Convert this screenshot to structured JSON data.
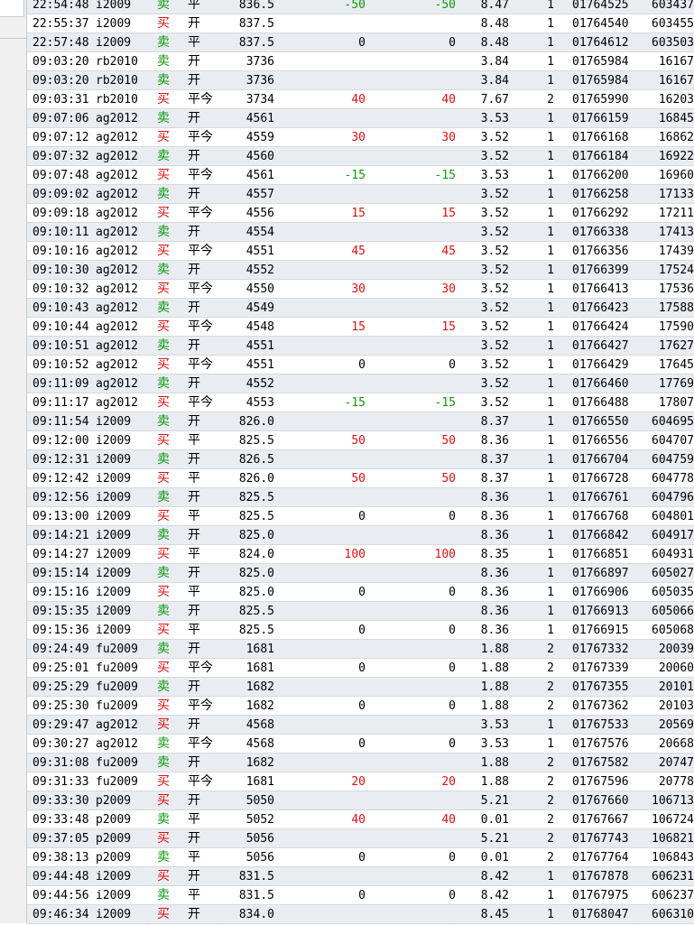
{
  "colors": {
    "buy": "#e01010",
    "sell": "#0a9a0a",
    "profit": "#e01010",
    "loss": "#0a9a0a",
    "row_alt": "#e9ecf1"
  },
  "rows": [
    {
      "time": "22:54:48",
      "symbol": "i2009",
      "dir": "卖",
      "oc": "平",
      "price": "836.5",
      "pl": "-50",
      "pl2": "-50",
      "fee": "8.47",
      "qty": "1",
      "order": "01764525",
      "id": "603437"
    },
    {
      "time": "22:55:37",
      "symbol": "i2009",
      "dir": "买",
      "oc": "开",
      "price": "837.5",
      "pl": "",
      "pl2": "",
      "fee": "8.48",
      "qty": "1",
      "order": "01764540",
      "id": "603455"
    },
    {
      "time": "22:57:48",
      "symbol": "i2009",
      "dir": "卖",
      "oc": "平",
      "price": "837.5",
      "pl": "0",
      "pl2": "0",
      "fee": "8.48",
      "qty": "1",
      "order": "01764612",
      "id": "603503"
    },
    {
      "time": "09:03:20",
      "symbol": "rb2010",
      "dir": "卖",
      "oc": "开",
      "price": "3736",
      "pl": "",
      "pl2": "",
      "fee": "3.84",
      "qty": "1",
      "order": "01765984",
      "id": "16167"
    },
    {
      "time": "09:03:20",
      "symbol": "rb2010",
      "dir": "卖",
      "oc": "开",
      "price": "3736",
      "pl": "",
      "pl2": "",
      "fee": "3.84",
      "qty": "1",
      "order": "01765984",
      "id": "16167"
    },
    {
      "time": "09:03:31",
      "symbol": "rb2010",
      "dir": "买",
      "oc": "平今",
      "price": "3734",
      "pl": "40",
      "pl2": "40",
      "fee": "7.67",
      "qty": "2",
      "order": "01765990",
      "id": "16203"
    },
    {
      "time": "09:07:06",
      "symbol": "ag2012",
      "dir": "卖",
      "oc": "开",
      "price": "4561",
      "pl": "",
      "pl2": "",
      "fee": "3.53",
      "qty": "1",
      "order": "01766159",
      "id": "16845"
    },
    {
      "time": "09:07:12",
      "symbol": "ag2012",
      "dir": "买",
      "oc": "平今",
      "price": "4559",
      "pl": "30",
      "pl2": "30",
      "fee": "3.52",
      "qty": "1",
      "order": "01766168",
      "id": "16862"
    },
    {
      "time": "09:07:32",
      "symbol": "ag2012",
      "dir": "卖",
      "oc": "开",
      "price": "4560",
      "pl": "",
      "pl2": "",
      "fee": "3.52",
      "qty": "1",
      "order": "01766184",
      "id": "16922"
    },
    {
      "time": "09:07:48",
      "symbol": "ag2012",
      "dir": "买",
      "oc": "平今",
      "price": "4561",
      "pl": "-15",
      "pl2": "-15",
      "fee": "3.53",
      "qty": "1",
      "order": "01766200",
      "id": "16960"
    },
    {
      "time": "09:09:02",
      "symbol": "ag2012",
      "dir": "卖",
      "oc": "开",
      "price": "4557",
      "pl": "",
      "pl2": "",
      "fee": "3.52",
      "qty": "1",
      "order": "01766258",
      "id": "17133"
    },
    {
      "time": "09:09:18",
      "symbol": "ag2012",
      "dir": "买",
      "oc": "平今",
      "price": "4556",
      "pl": "15",
      "pl2": "15",
      "fee": "3.52",
      "qty": "1",
      "order": "01766292",
      "id": "17211"
    },
    {
      "time": "09:10:11",
      "symbol": "ag2012",
      "dir": "卖",
      "oc": "开",
      "price": "4554",
      "pl": "",
      "pl2": "",
      "fee": "3.52",
      "qty": "1",
      "order": "01766338",
      "id": "17413"
    },
    {
      "time": "09:10:16",
      "symbol": "ag2012",
      "dir": "买",
      "oc": "平今",
      "price": "4551",
      "pl": "45",
      "pl2": "45",
      "fee": "3.52",
      "qty": "1",
      "order": "01766356",
      "id": "17439"
    },
    {
      "time": "09:10:30",
      "symbol": "ag2012",
      "dir": "卖",
      "oc": "开",
      "price": "4552",
      "pl": "",
      "pl2": "",
      "fee": "3.52",
      "qty": "1",
      "order": "01766399",
      "id": "17524"
    },
    {
      "time": "09:10:32",
      "symbol": "ag2012",
      "dir": "买",
      "oc": "平今",
      "price": "4550",
      "pl": "30",
      "pl2": "30",
      "fee": "3.52",
      "qty": "1",
      "order": "01766413",
      "id": "17536"
    },
    {
      "time": "09:10:43",
      "symbol": "ag2012",
      "dir": "卖",
      "oc": "开",
      "price": "4549",
      "pl": "",
      "pl2": "",
      "fee": "3.52",
      "qty": "1",
      "order": "01766423",
      "id": "17588"
    },
    {
      "time": "09:10:44",
      "symbol": "ag2012",
      "dir": "买",
      "oc": "平今",
      "price": "4548",
      "pl": "15",
      "pl2": "15",
      "fee": "3.52",
      "qty": "1",
      "order": "01766424",
      "id": "17590"
    },
    {
      "time": "09:10:51",
      "symbol": "ag2012",
      "dir": "卖",
      "oc": "开",
      "price": "4551",
      "pl": "",
      "pl2": "",
      "fee": "3.52",
      "qty": "1",
      "order": "01766427",
      "id": "17627"
    },
    {
      "time": "09:10:52",
      "symbol": "ag2012",
      "dir": "买",
      "oc": "平今",
      "price": "4551",
      "pl": "0",
      "pl2": "0",
      "fee": "3.52",
      "qty": "1",
      "order": "01766429",
      "id": "17645"
    },
    {
      "time": "09:11:09",
      "symbol": "ag2012",
      "dir": "卖",
      "oc": "开",
      "price": "4552",
      "pl": "",
      "pl2": "",
      "fee": "3.52",
      "qty": "1",
      "order": "01766460",
      "id": "17769"
    },
    {
      "time": "09:11:17",
      "symbol": "ag2012",
      "dir": "买",
      "oc": "平今",
      "price": "4553",
      "pl": "-15",
      "pl2": "-15",
      "fee": "3.52",
      "qty": "1",
      "order": "01766488",
      "id": "17807"
    },
    {
      "time": "09:11:54",
      "symbol": "i2009",
      "dir": "卖",
      "oc": "开",
      "price": "826.0",
      "pl": "",
      "pl2": "",
      "fee": "8.37",
      "qty": "1",
      "order": "01766550",
      "id": "604695"
    },
    {
      "time": "09:12:00",
      "symbol": "i2009",
      "dir": "买",
      "oc": "平",
      "price": "825.5",
      "pl": "50",
      "pl2": "50",
      "fee": "8.36",
      "qty": "1",
      "order": "01766556",
      "id": "604707"
    },
    {
      "time": "09:12:31",
      "symbol": "i2009",
      "dir": "卖",
      "oc": "开",
      "price": "826.5",
      "pl": "",
      "pl2": "",
      "fee": "8.37",
      "qty": "1",
      "order": "01766704",
      "id": "604759"
    },
    {
      "time": "09:12:42",
      "symbol": "i2009",
      "dir": "买",
      "oc": "平",
      "price": "826.0",
      "pl": "50",
      "pl2": "50",
      "fee": "8.37",
      "qty": "1",
      "order": "01766728",
      "id": "604778"
    },
    {
      "time": "09:12:56",
      "symbol": "i2009",
      "dir": "卖",
      "oc": "开",
      "price": "825.5",
      "pl": "",
      "pl2": "",
      "fee": "8.36",
      "qty": "1",
      "order": "01766761",
      "id": "604796"
    },
    {
      "time": "09:13:00",
      "symbol": "i2009",
      "dir": "买",
      "oc": "平",
      "price": "825.5",
      "pl": "0",
      "pl2": "0",
      "fee": "8.36",
      "qty": "1",
      "order": "01766768",
      "id": "604801"
    },
    {
      "time": "09:14:21",
      "symbol": "i2009",
      "dir": "卖",
      "oc": "开",
      "price": "825.0",
      "pl": "",
      "pl2": "",
      "fee": "8.36",
      "qty": "1",
      "order": "01766842",
      "id": "604917"
    },
    {
      "time": "09:14:27",
      "symbol": "i2009",
      "dir": "买",
      "oc": "平",
      "price": "824.0",
      "pl": "100",
      "pl2": "100",
      "fee": "8.35",
      "qty": "1",
      "order": "01766851",
      "id": "604931"
    },
    {
      "time": "09:15:14",
      "symbol": "i2009",
      "dir": "卖",
      "oc": "开",
      "price": "825.0",
      "pl": "",
      "pl2": "",
      "fee": "8.36",
      "qty": "1",
      "order": "01766897",
      "id": "605027"
    },
    {
      "time": "09:15:16",
      "symbol": "i2009",
      "dir": "买",
      "oc": "平",
      "price": "825.0",
      "pl": "0",
      "pl2": "0",
      "fee": "8.36",
      "qty": "1",
      "order": "01766906",
      "id": "605035"
    },
    {
      "time": "09:15:35",
      "symbol": "i2009",
      "dir": "卖",
      "oc": "开",
      "price": "825.5",
      "pl": "",
      "pl2": "",
      "fee": "8.36",
      "qty": "1",
      "order": "01766913",
      "id": "605066"
    },
    {
      "time": "09:15:36",
      "symbol": "i2009",
      "dir": "买",
      "oc": "平",
      "price": "825.5",
      "pl": "0",
      "pl2": "0",
      "fee": "8.36",
      "qty": "1",
      "order": "01766915",
      "id": "605068"
    },
    {
      "time": "09:24:49",
      "symbol": "fu2009",
      "dir": "卖",
      "oc": "开",
      "price": "1681",
      "pl": "",
      "pl2": "",
      "fee": "1.88",
      "qty": "2",
      "order": "01767332",
      "id": "20039"
    },
    {
      "time": "09:25:01",
      "symbol": "fu2009",
      "dir": "买",
      "oc": "平今",
      "price": "1681",
      "pl": "0",
      "pl2": "0",
      "fee": "1.88",
      "qty": "2",
      "order": "01767339",
      "id": "20060"
    },
    {
      "time": "09:25:29",
      "symbol": "fu2009",
      "dir": "卖",
      "oc": "开",
      "price": "1682",
      "pl": "",
      "pl2": "",
      "fee": "1.88",
      "qty": "2",
      "order": "01767355",
      "id": "20101"
    },
    {
      "time": "09:25:30",
      "symbol": "fu2009",
      "dir": "买",
      "oc": "平今",
      "price": "1682",
      "pl": "0",
      "pl2": "0",
      "fee": "1.88",
      "qty": "2",
      "order": "01767362",
      "id": "20103"
    },
    {
      "time": "09:29:47",
      "symbol": "ag2012",
      "dir": "买",
      "oc": "开",
      "price": "4568",
      "pl": "",
      "pl2": "",
      "fee": "3.53",
      "qty": "1",
      "order": "01767533",
      "id": "20569"
    },
    {
      "time": "09:30:27",
      "symbol": "ag2012",
      "dir": "卖",
      "oc": "平今",
      "price": "4568",
      "pl": "0",
      "pl2": "0",
      "fee": "3.53",
      "qty": "1",
      "order": "01767576",
      "id": "20668"
    },
    {
      "time": "09:31:08",
      "symbol": "fu2009",
      "dir": "卖",
      "oc": "开",
      "price": "1682",
      "pl": "",
      "pl2": "",
      "fee": "1.88",
      "qty": "2",
      "order": "01767582",
      "id": "20747"
    },
    {
      "time": "09:31:33",
      "symbol": "fu2009",
      "dir": "买",
      "oc": "平今",
      "price": "1681",
      "pl": "20",
      "pl2": "20",
      "fee": "1.88",
      "qty": "2",
      "order": "01767596",
      "id": "20778"
    },
    {
      "time": "09:33:30",
      "symbol": "p2009",
      "dir": "买",
      "oc": "开",
      "price": "5050",
      "pl": "",
      "pl2": "",
      "fee": "5.21",
      "qty": "2",
      "order": "01767660",
      "id": "106713"
    },
    {
      "time": "09:33:48",
      "symbol": "p2009",
      "dir": "卖",
      "oc": "平",
      "price": "5052",
      "pl": "40",
      "pl2": "40",
      "fee": "0.01",
      "qty": "2",
      "order": "01767667",
      "id": "106724"
    },
    {
      "time": "09:37:05",
      "symbol": "p2009",
      "dir": "买",
      "oc": "开",
      "price": "5056",
      "pl": "",
      "pl2": "",
      "fee": "5.21",
      "qty": "2",
      "order": "01767743",
      "id": "106821"
    },
    {
      "time": "09:38:13",
      "symbol": "p2009",
      "dir": "卖",
      "oc": "平",
      "price": "5056",
      "pl": "0",
      "pl2": "0",
      "fee": "0.01",
      "qty": "2",
      "order": "01767764",
      "id": "106843"
    },
    {
      "time": "09:44:48",
      "symbol": "i2009",
      "dir": "买",
      "oc": "开",
      "price": "831.5",
      "pl": "",
      "pl2": "",
      "fee": "8.42",
      "qty": "1",
      "order": "01767878",
      "id": "606231"
    },
    {
      "time": "09:44:56",
      "symbol": "i2009",
      "dir": "卖",
      "oc": "平",
      "price": "831.5",
      "pl": "0",
      "pl2": "0",
      "fee": "8.42",
      "qty": "1",
      "order": "01767975",
      "id": "606237"
    },
    {
      "time": "09:46:34",
      "symbol": "i2009",
      "dir": "买",
      "oc": "开",
      "price": "834.0",
      "pl": "",
      "pl2": "",
      "fee": "8.45",
      "qty": "1",
      "order": "01768047",
      "id": "606310"
    }
  ]
}
